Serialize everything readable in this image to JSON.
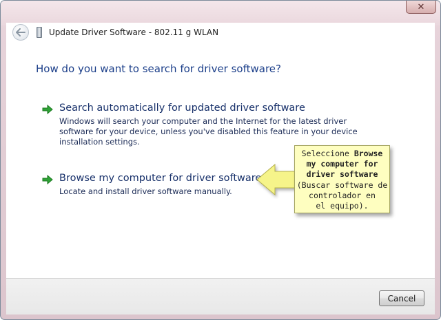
{
  "window": {
    "title": "Update Driver Software - 802.11 g WLAN",
    "close_label": "✕"
  },
  "heading": "How do you want to search for driver software?",
  "options": [
    {
      "title": "Search automatically for updated driver software",
      "description": "Windows will search your computer and the Internet for the latest driver software for your device, unless you've disabled this feature in your device installation settings.",
      "icon": "green-arrow-icon"
    },
    {
      "title": "Browse my computer for driver software",
      "description": "Locate and install driver software manually.",
      "icon": "green-arrow-icon"
    }
  ],
  "callout": {
    "lines": [
      {
        "text": "Seleccione Browse",
        "bold": false
      },
      {
        "text": "my computer for",
        "bold": true
      },
      {
        "text": "driver software",
        "bold": true
      },
      {
        "text": "(Buscar software de",
        "bold": false
      },
      {
        "text": "controlador en",
        "bold": false
      },
      {
        "text": "el equipo).",
        "bold": false
      }
    ],
    "color": "#fefec0"
  },
  "footer": {
    "cancel_label": "Cancel"
  }
}
